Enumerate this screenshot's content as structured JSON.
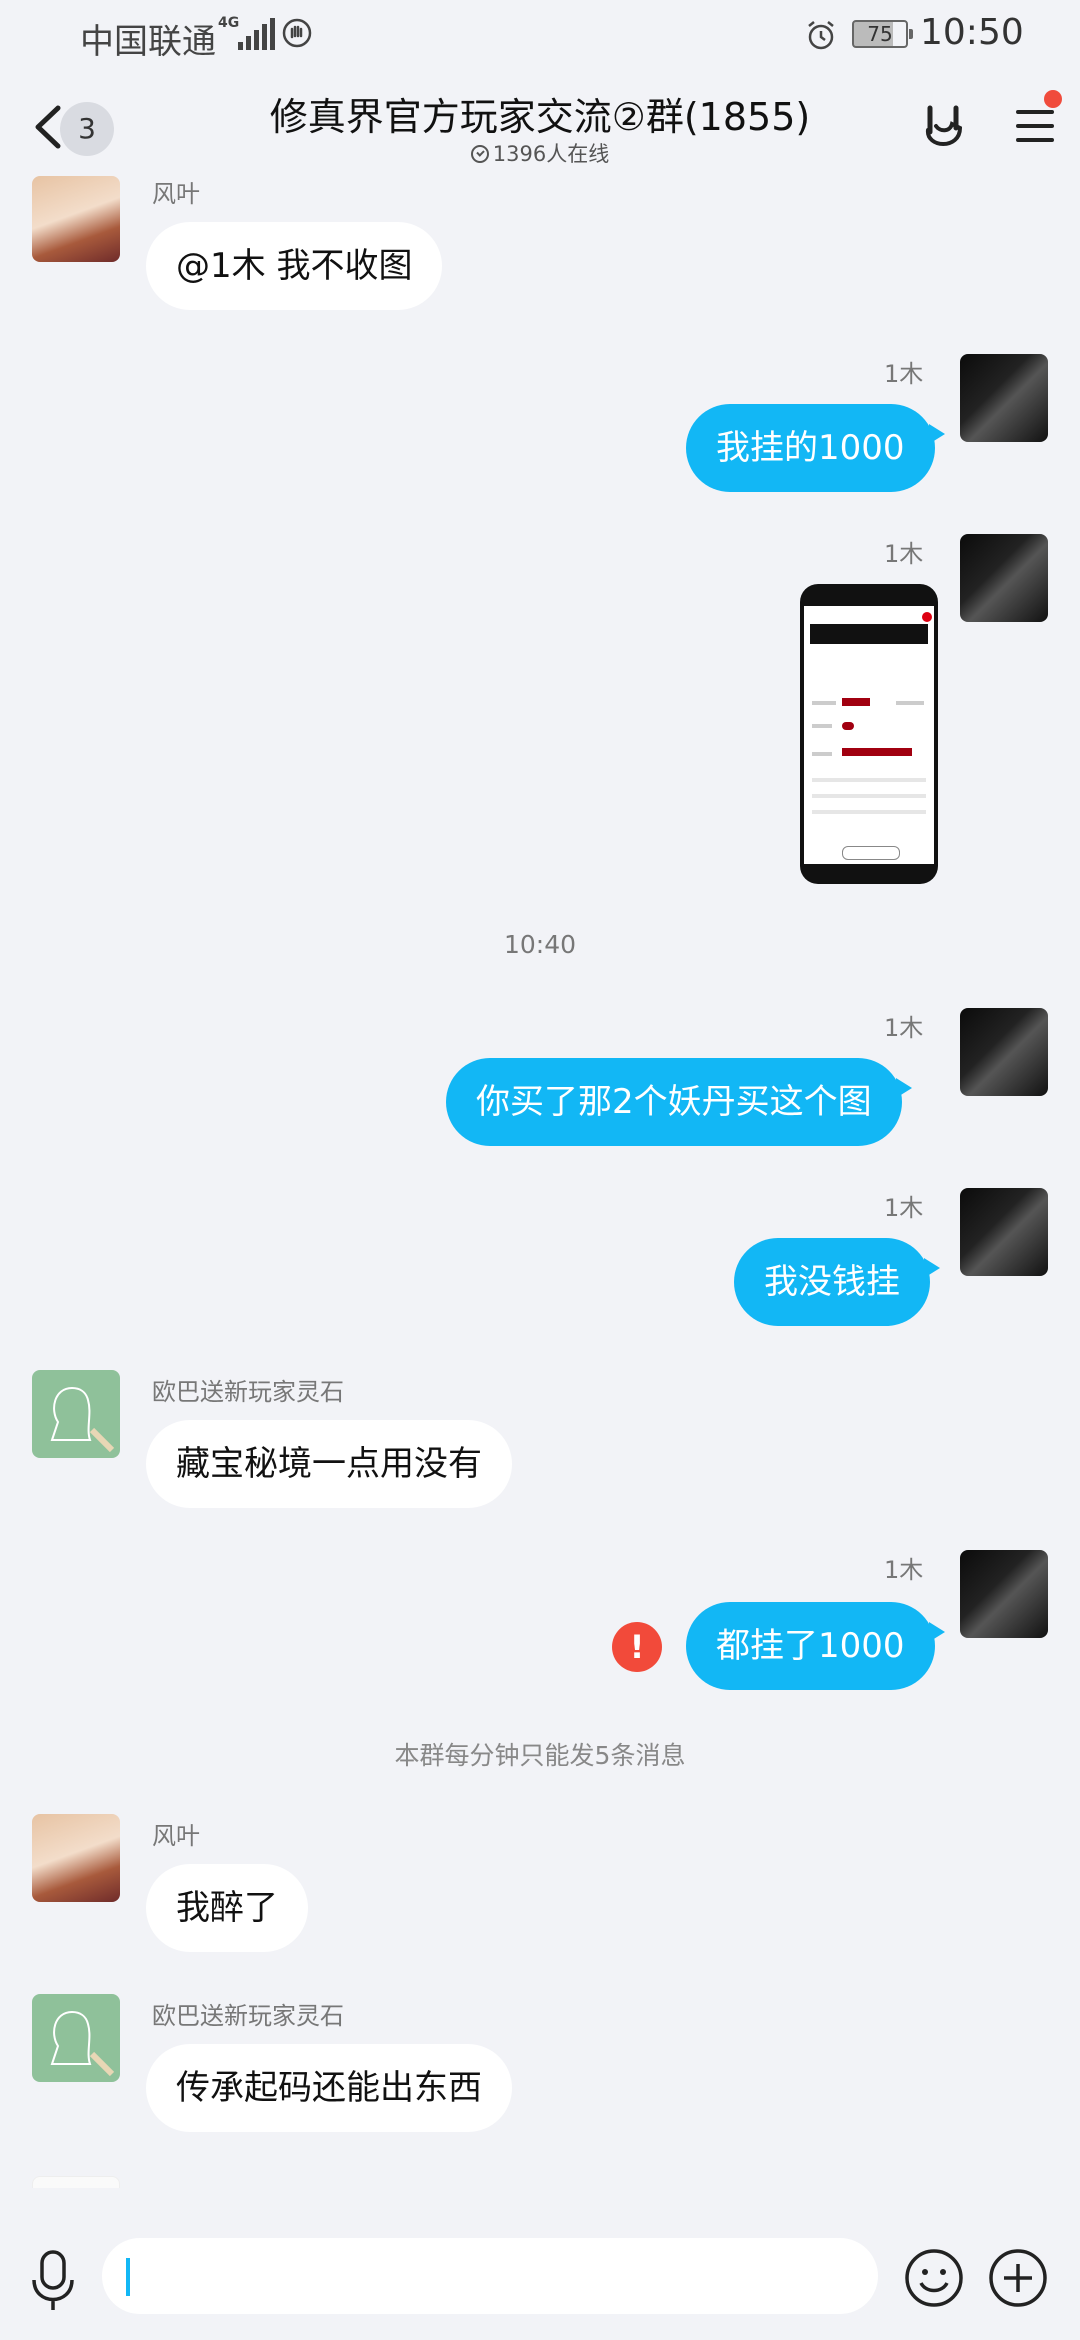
{
  "status_bar": {
    "carrier": "中国联通",
    "network": "4G",
    "battery": "75",
    "time": "10:50",
    "icons": [
      "signal-icon",
      "hand-icon",
      "alarm-icon",
      "battery-icon"
    ]
  },
  "header": {
    "unread_count": "3",
    "title": "修真界官方玩家交流②群(1855)",
    "online": "1396人在线",
    "icons": [
      "back-arrow-icon",
      "rock-hand-icon",
      "menu-icon"
    ],
    "menu_badge_color": "#f04b3c"
  },
  "messages": [
    {
      "sender": "风叶",
      "text": "@1木 我不收图"
    },
    {
      "sender": "1木",
      "text": "我挂的1000"
    },
    {
      "sender": "1木",
      "type": "image"
    },
    {
      "sender": "1木",
      "text": "你买了那2个妖丹买这个图"
    },
    {
      "sender": "1木",
      "text": "我没钱挂"
    },
    {
      "sender": "欧巴送新玩家灵石",
      "text": "藏宝秘境一点用没有"
    },
    {
      "sender": "1木",
      "text": "都挂了1000",
      "failed": true
    },
    {
      "sender": "风叶",
      "text": "我醉了"
    },
    {
      "sender": "欧巴送新玩家灵石",
      "text": "传承起码还能出东西"
    },
    {
      "sender": "~"
    }
  ],
  "time_divider": "10:40",
  "system_notice": "本群每分钟只能发5条消息",
  "colors": {
    "outgoing_bubble": "#12b7f5",
    "incoming_bubble": "#ffffff",
    "background": "#f2f3f7",
    "error": "#f24a3a"
  },
  "input_bar": {
    "icons": [
      "microphone-icon",
      "emoji-icon",
      "plus-icon"
    ]
  }
}
